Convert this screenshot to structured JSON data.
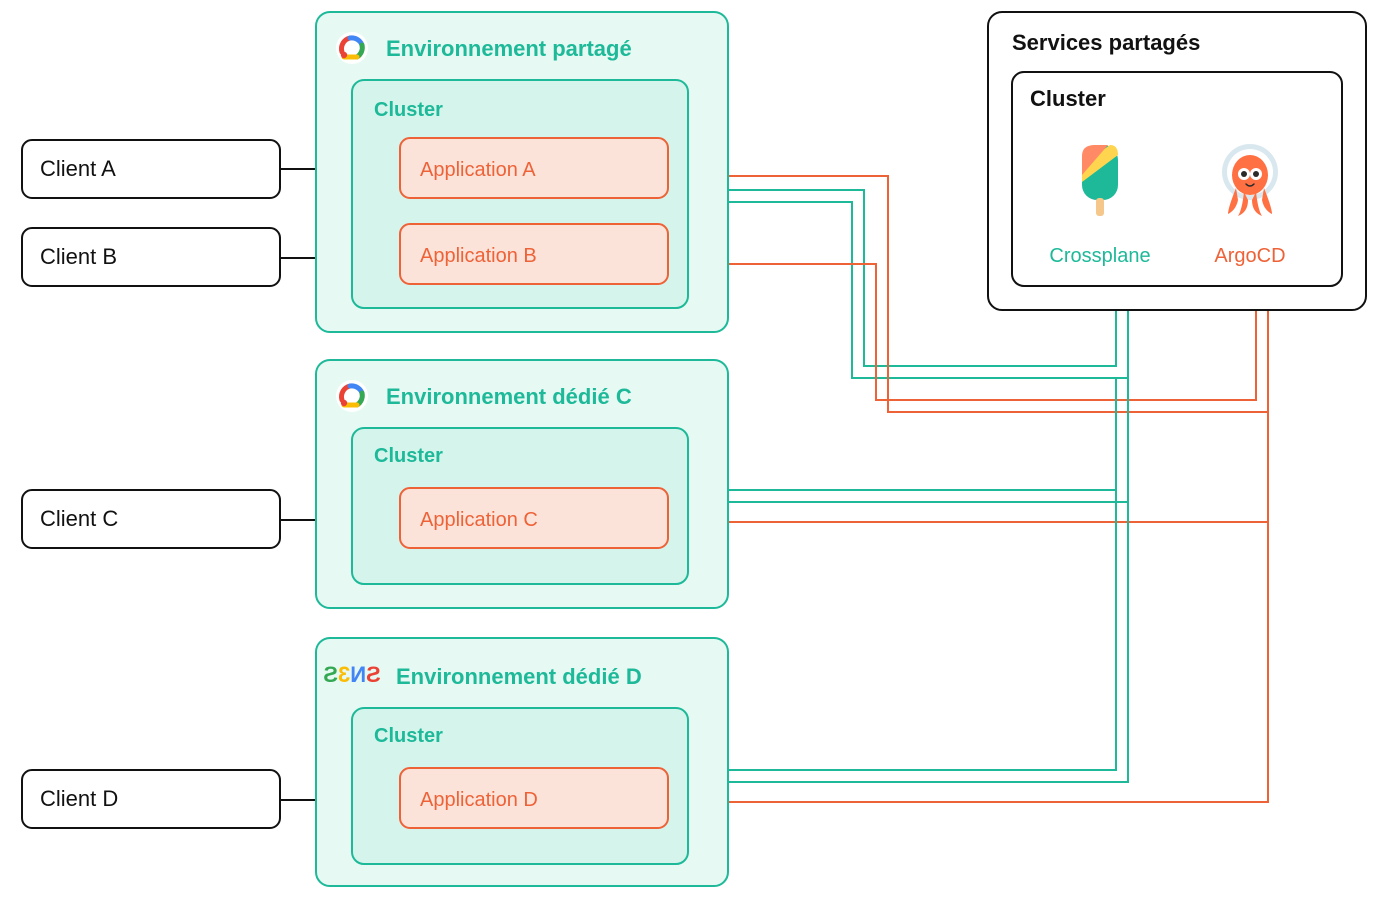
{
  "colors": {
    "teal": "#1db999",
    "teal_light_fill": "#e6faf3",
    "teal_mid_fill": "#d5f5ec",
    "orange": "#ee6237",
    "orange_fill": "#fce3da",
    "black": "#111111"
  },
  "clients": {
    "a": "Client A",
    "b": "Client B",
    "c": "Client C",
    "d": "Client D"
  },
  "environments": {
    "shared": {
      "title": "Environnement partagé",
      "cluster": "Cluster",
      "apps": {
        "a": "Application A",
        "b": "Application B"
      },
      "provider": "gcp"
    },
    "dedicated_c": {
      "title": "Environnement dédié C",
      "cluster": "Cluster",
      "apps": {
        "c": "Application C"
      },
      "provider": "gcp"
    },
    "dedicated_d": {
      "title": "Environnement dédié D",
      "cluster": "Cluster",
      "apps": {
        "d": "Application D"
      },
      "provider": "s3ns"
    }
  },
  "shared_services": {
    "title": "Services partagés",
    "cluster": "Cluster",
    "tools": {
      "crossplane": "Crossplane",
      "argocd": "ArgoCD"
    }
  }
}
